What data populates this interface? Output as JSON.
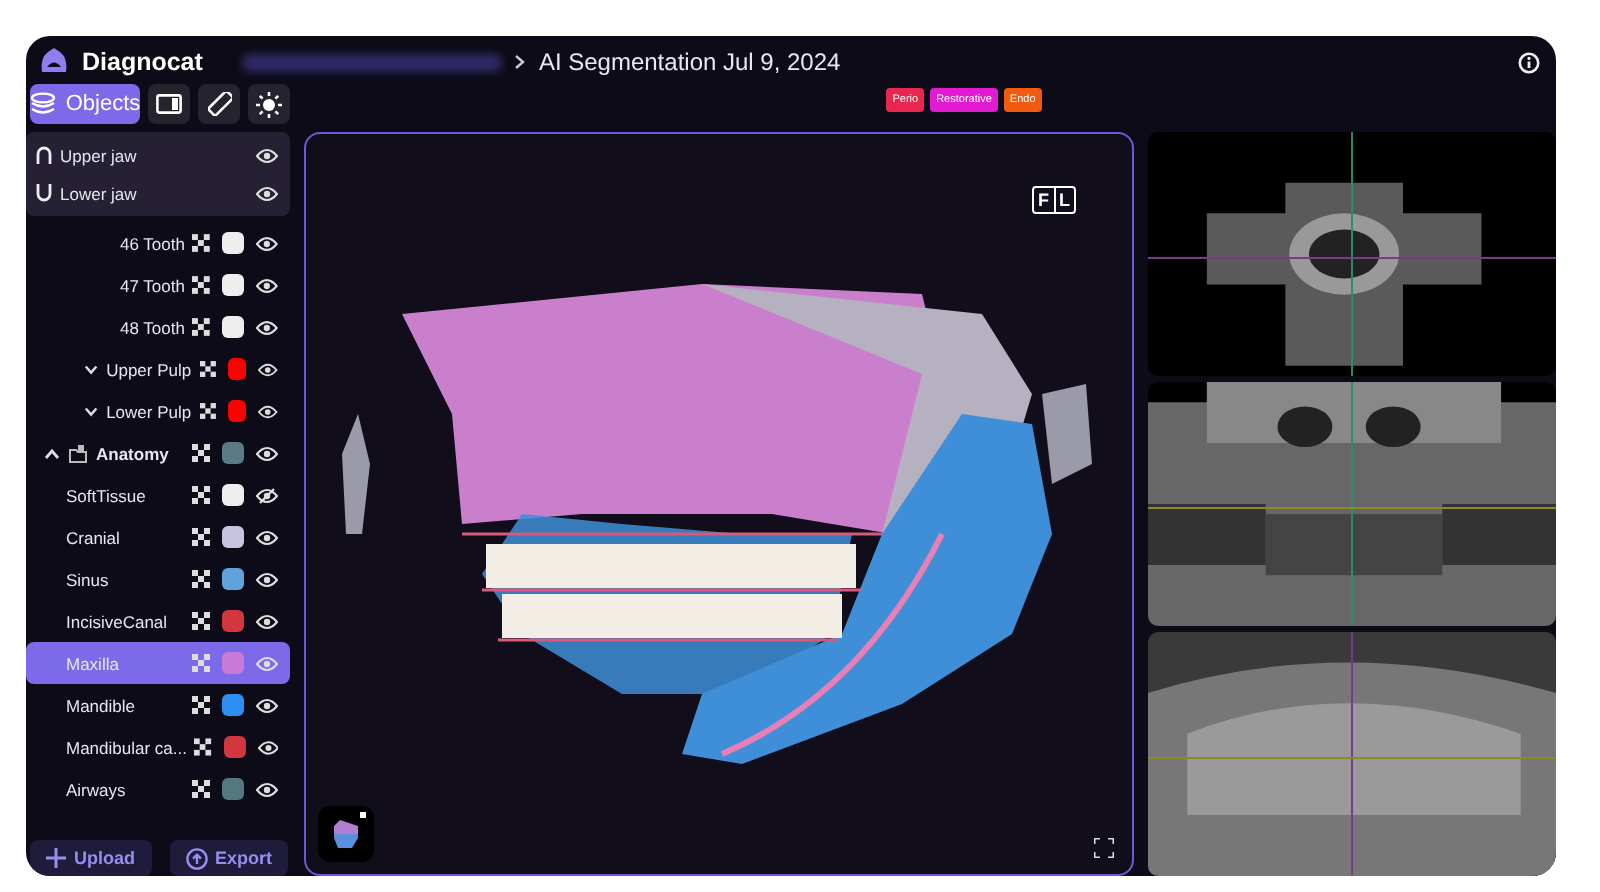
{
  "header": {
    "app_name": "Diagnocat",
    "breadcrumb": "AI Segmentation Jul 9, 2024"
  },
  "toolbar": [
    {
      "kind": "objects",
      "label": "Objects",
      "selected": true
    },
    {
      "kind": "panel",
      "selected": false
    },
    {
      "kind": "ruler",
      "selected": false
    },
    {
      "kind": "brightness",
      "selected": false
    }
  ],
  "badges": [
    {
      "label": "Perio",
      "color": "#e8264f"
    },
    {
      "label": "Restorative",
      "color": "#e21bd0"
    },
    {
      "label": "Endo",
      "color": "#f25a0f"
    }
  ],
  "jaws": [
    {
      "kind": "upper",
      "label": "Upper jaw",
      "visible": true
    },
    {
      "kind": "lower",
      "label": "Lower jaw",
      "visible": true
    }
  ],
  "objects": [
    {
      "kind": "tooth",
      "name": "46 Tooth",
      "color": "#eeeeee",
      "visible": true,
      "selected": false
    },
    {
      "kind": "tooth",
      "name": "47 Tooth",
      "color": "#eeeeee",
      "visible": true,
      "selected": false
    },
    {
      "kind": "tooth",
      "name": "48 Tooth",
      "color": "#eeeeee",
      "visible": true,
      "selected": false
    },
    {
      "kind": "group",
      "name": "Upper Pulp",
      "color": "#ff0000",
      "visible": true,
      "selected": false,
      "expanded": false
    },
    {
      "kind": "group",
      "name": "Lower Pulp",
      "color": "#ff0000",
      "visible": true,
      "selected": false,
      "expanded": false
    },
    {
      "kind": "category",
      "name": "Anatomy",
      "color": "#5a7a85",
      "visible": true,
      "selected": false,
      "expanded": true,
      "children": [
        {
          "kind": "leaf",
          "name": "SoftTissue",
          "color": "#eeeeee",
          "visible": false,
          "selected": false
        },
        {
          "kind": "leaf",
          "name": "Cranial",
          "color": "#c5c5e0",
          "visible": true,
          "selected": false
        },
        {
          "kind": "leaf",
          "name": "Sinus",
          "color": "#5fa2dc",
          "visible": true,
          "selected": false
        },
        {
          "kind": "leaf",
          "name": "IncisiveCanal",
          "color": "#d2363f",
          "visible": true,
          "selected": false
        },
        {
          "kind": "leaf",
          "name": "Maxilla",
          "color": "#c77ad8",
          "visible": true,
          "selected": true
        },
        {
          "kind": "leaf",
          "name": "Mandible",
          "color": "#2b8ef0",
          "visible": true,
          "selected": false
        },
        {
          "kind": "leaf",
          "name": "Mandibular ca...",
          "color": "#d2363f",
          "visible": true,
          "selected": false
        },
        {
          "kind": "leaf",
          "name": "Airways",
          "color": "#557780",
          "visible": true,
          "selected": false
        }
      ]
    }
  ],
  "actions": [
    {
      "kind": "upload",
      "label": "Upload"
    },
    {
      "kind": "export",
      "label": "Export"
    }
  ],
  "viewer": {
    "orientation": [
      "F",
      "L"
    ]
  }
}
